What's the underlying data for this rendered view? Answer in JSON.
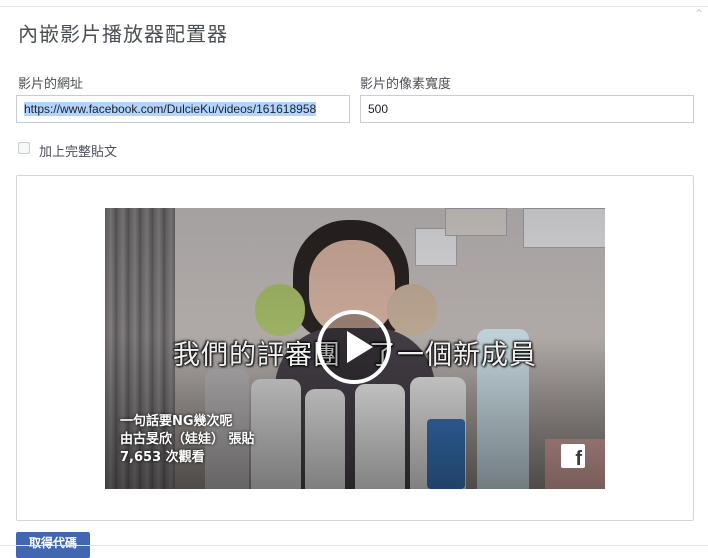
{
  "dialog": {
    "title": "內嵌影片播放器配置器",
    "collapse_icon": "chevron-up-icon"
  },
  "url_field": {
    "label": "影片的網址",
    "value": "https://www.facebook.com/DulcieKu/videos/161618958"
  },
  "width_field": {
    "label": "影片的像素寬度",
    "value": "500"
  },
  "full_post": {
    "label": "加上完整貼文",
    "checked": false
  },
  "video": {
    "subtitle": "我們的評審團　了一個新成員",
    "title": "一句話要NG幾次呢",
    "author": "由古旻欣（娃娃） 張貼",
    "views": "7,653 次觀看",
    "play_icon": "play-icon",
    "brand_icon": "facebook-icon"
  },
  "actions": {
    "get_code_label": "取得代碼"
  }
}
